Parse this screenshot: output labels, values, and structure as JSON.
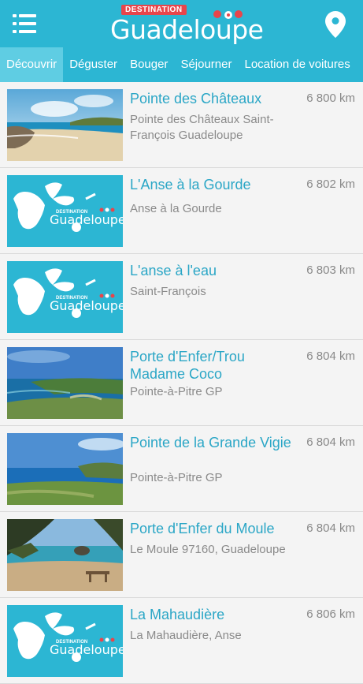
{
  "header": {
    "logo_badge": "DESTINATION",
    "logo_name": "Guadeloupe",
    "colors": {
      "bar": "#2cb6d3",
      "active_tab": "#5fcde3",
      "title": "#2aa6c6",
      "badge": "#e8454b"
    }
  },
  "tabs": [
    {
      "label": "Découvrir",
      "active": true
    },
    {
      "label": "Déguster"
    },
    {
      "label": "Bouger"
    },
    {
      "label": "Séjourner"
    },
    {
      "label": "Location de voitures"
    }
  ],
  "items": [
    {
      "title": "Pointe des Châteaux",
      "subtitle": "Pointe des Châteaux Saint-François Guadeloupe",
      "distance": "6 800 km",
      "thumb": "beach-photo"
    },
    {
      "title": "L'Anse à la Gourde",
      "subtitle": "Anse à la Gourde",
      "distance": "6 802 km",
      "thumb": "placeholder-logo"
    },
    {
      "title": "L'anse à l'eau",
      "subtitle": "Saint-François",
      "distance": "6 803 km",
      "thumb": "placeholder-logo"
    },
    {
      "title": "Porte d'Enfer/Trou Madame Coco",
      "subtitle": "Pointe-à-Pitre GP",
      "distance": "6 804 km",
      "thumb": "coast-photo"
    },
    {
      "title": "Pointe de la Grande Vigie",
      "subtitle": "Pointe-à-Pitre GP",
      "distance": "6 804 km",
      "thumb": "cliff-photo"
    },
    {
      "title": "Porte d'Enfer du Moule",
      "subtitle": "Le Moule 97160, Guadeloupe",
      "distance": "6 804 km",
      "thumb": "palm-photo"
    },
    {
      "title": "La Mahaudière",
      "subtitle": "La Mahaudière, Anse",
      "distance": "6 806 km",
      "thumb": "placeholder-logo"
    }
  ]
}
